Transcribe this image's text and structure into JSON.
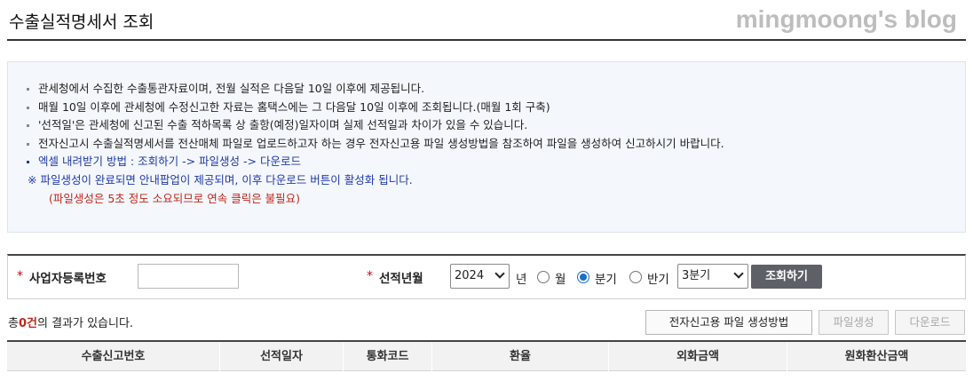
{
  "page": {
    "title": "수출실적명세서 조회",
    "watermark": "mingmoong's blog"
  },
  "notice": {
    "lines": [
      "관세청에서 수집한 수출통관자료이며, 전월 실적은 다음달 10일 이후에 제공됩니다.",
      "매월 10일 이후에 관세청에 수정신고한 자료는 홈택스에는 그 다음달 10일 이후에 조회됩니다.(매월 1회 구축)",
      "'선적일'은 관세청에 신고된 수출 적하목록 상 출항(예정)일자이며 실제 선적일과 차이가 있을 수 있습니다.",
      "전자신고시 수출실적명세서를 전산매체 파일로 업로드하고자 하는 경우 전자신고용 파일 생성방법을 참조하여 파일을 생성하여 신고하시기 바랍니다.",
      "엑셀 내려받기 방법 :   조회하기 ->   파일생성 -> 다운로드"
    ],
    "note": "※ 파일생성이 완료되면 안내팝업이 제공되며, 이후   다운로드 버튼이 활성화 됩니다.",
    "warning": "(파일생성은 5초 정도 소요되므로 연속 클릭은 불필요)"
  },
  "search": {
    "required_mark": "*",
    "biz_label": "사업자등록번호",
    "biz_value": "",
    "year_label": "선적년월",
    "year_value": "2024",
    "year_suffix": "년",
    "period_options": [
      "월",
      "분기",
      "반기"
    ],
    "period_selected": "분기",
    "quarter_value": "3분기",
    "search_button": "조회하기"
  },
  "result": {
    "prefix": "총",
    "count": "0건",
    "suffix": "의 결과가 있습니다."
  },
  "actions": {
    "guide_button": "전자신고용 파일 생성방법",
    "file_create_button": "파일생성",
    "download_button": "다운로드"
  },
  "table": {
    "headers": [
      "수출신고번호",
      "선적일자",
      "통화코드",
      "환율",
      "외화금액",
      "원화환산금액"
    ]
  }
}
